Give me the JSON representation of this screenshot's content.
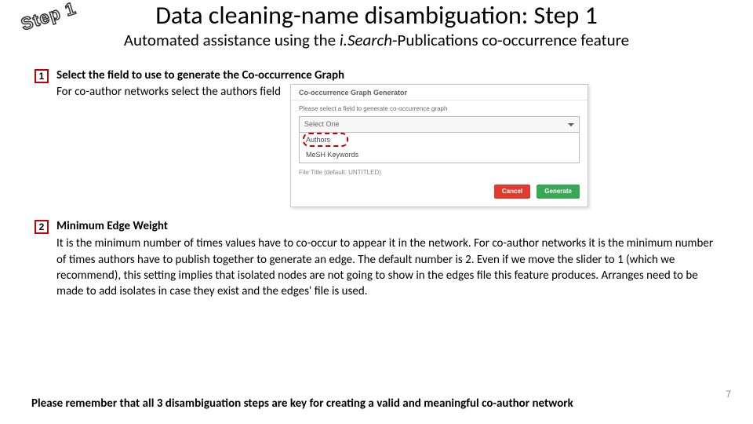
{
  "badge": "Step 1",
  "title": "Data cleaning-name disambiguation: Step 1",
  "subtitle_pre": "Automated assistance using the ",
  "subtitle_em": "i.Search",
  "subtitle_post": "-Publications co-occurrence feature",
  "items": [
    {
      "num": "1",
      "heading": "Select the field to use to generate the Co-occurrence Graph",
      "line2": "For co-author networks select the authors field"
    },
    {
      "num": "2",
      "heading": "Minimum Edge Weight",
      "body": "It is the minimum number of times values have to co-occur to appear it in the network. For co-author networks it is the minimum number of times authors have to publish together to generate an edge. The default number is 2. Even if we move the slider to 1 (which we recommend), this setting implies that isolated nodes are not going to show in the edges file this feature produces. Arranges need to be made to add isolates in case they exist and the edges' file is used."
    }
  ],
  "mini": {
    "title": "Co-occurrence Graph Generator",
    "prompt": "Please select a field to generate co-occurrence graph",
    "select_placeholder": "Select One",
    "options": [
      "Authors",
      "MeSH Keywords"
    ],
    "file_label": "File Title (default: UNTITLED)",
    "cancel": "Cancel",
    "generate": "Generate"
  },
  "footnote": "Please remember that all 3 disambiguation steps are key for creating a valid and meaningful co-author network",
  "page_number": "7"
}
